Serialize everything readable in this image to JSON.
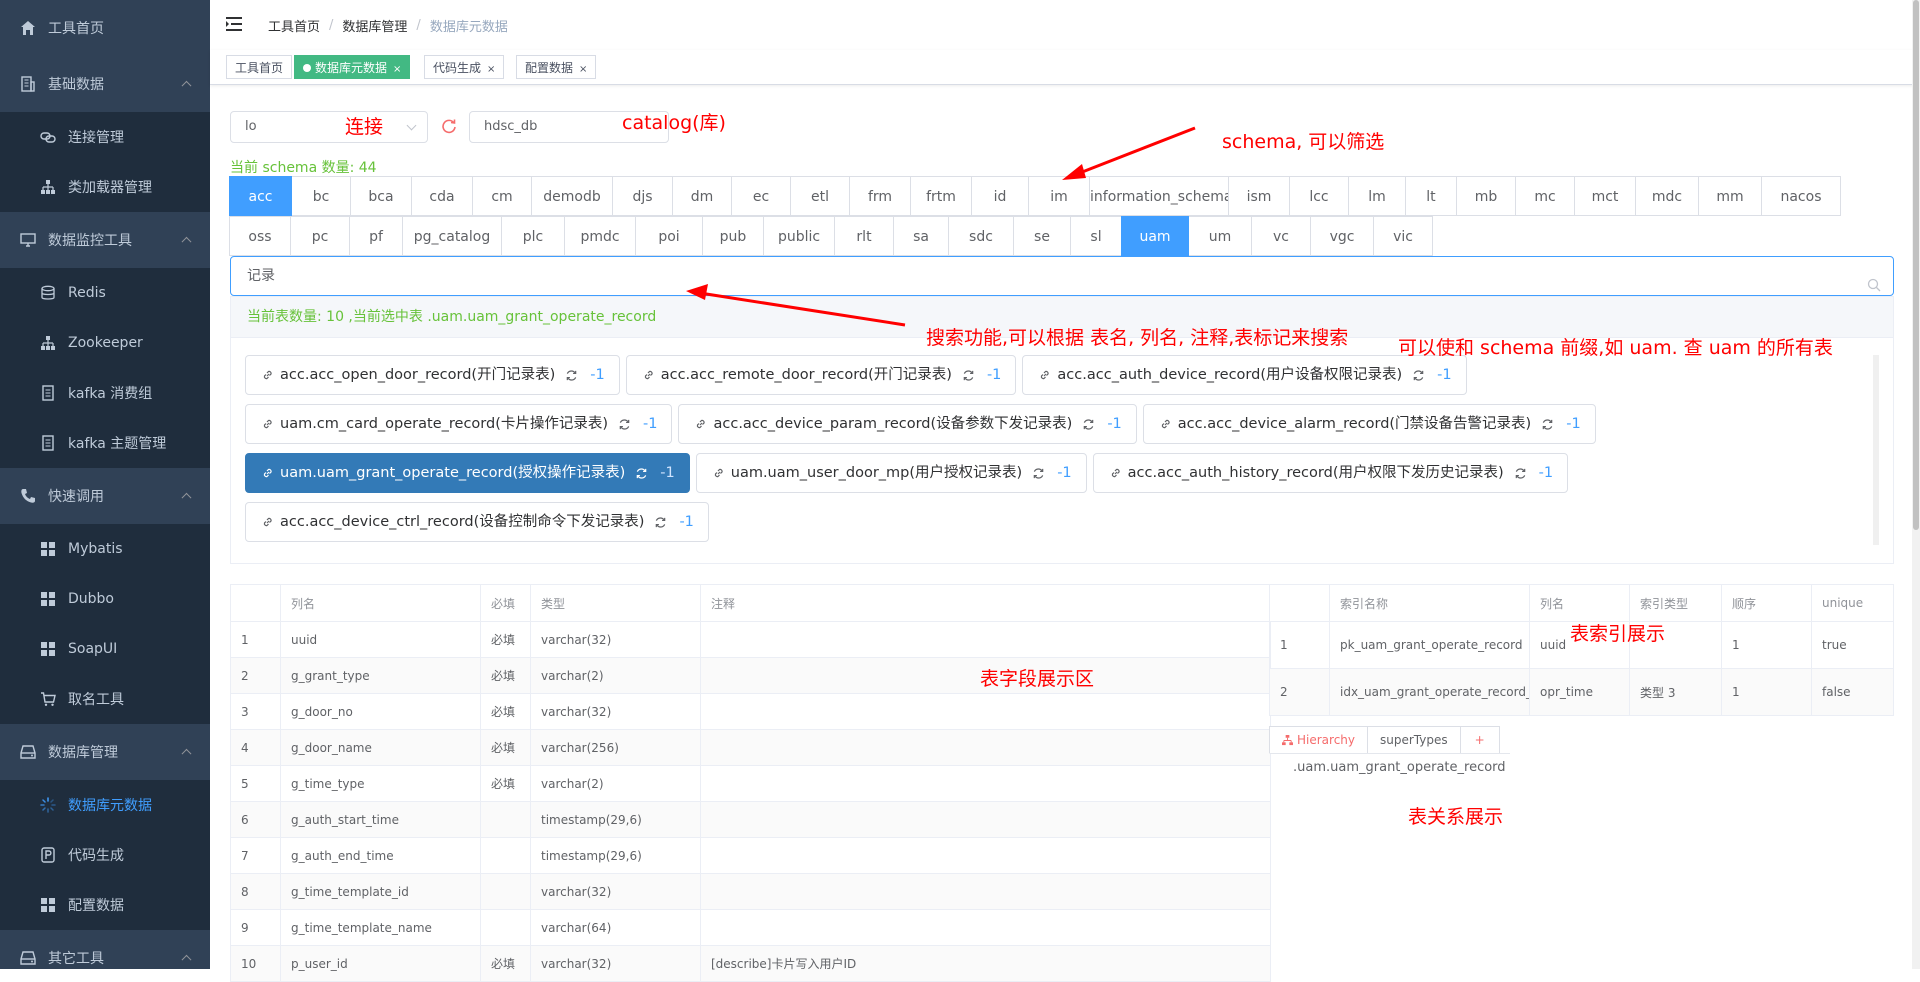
{
  "sidebar": {
    "items": [
      {
        "label": "工具首页",
        "icon": "home-icon",
        "type": "top"
      },
      {
        "label": "基础数据",
        "icon": "building-icon",
        "type": "top",
        "expandable": true
      },
      {
        "label": "连接管理",
        "icon": "link-icon",
        "type": "sub"
      },
      {
        "label": "类加载器管理",
        "icon": "sitemap-icon",
        "type": "sub"
      },
      {
        "label": "数据监控工具",
        "icon": "monitor-icon",
        "type": "top",
        "expandable": true
      },
      {
        "label": "Redis",
        "icon": "database-icon",
        "type": "sub"
      },
      {
        "label": "Zookeeper",
        "icon": "sitemap-icon",
        "type": "sub"
      },
      {
        "label": "kafka 消费组",
        "icon": "document-icon",
        "type": "sub"
      },
      {
        "label": "kafka 主题管理",
        "icon": "document-icon",
        "type": "sub"
      },
      {
        "label": "快速调用",
        "icon": "phone-icon",
        "type": "top",
        "expandable": true
      },
      {
        "label": "Mybatis",
        "icon": "grid-icon",
        "type": "sub"
      },
      {
        "label": "Dubbo",
        "icon": "grid-icon",
        "type": "sub"
      },
      {
        "label": "SoapUI",
        "icon": "grid-icon",
        "type": "sub"
      },
      {
        "label": "取名工具",
        "icon": "cart-icon",
        "type": "sub"
      },
      {
        "label": "数据库管理",
        "icon": "drive-icon",
        "type": "top",
        "expandable": true
      },
      {
        "label": "数据库元数据",
        "icon": "spinner-icon",
        "type": "sub",
        "active": true
      },
      {
        "label": "代码生成",
        "icon": "parking-icon",
        "type": "sub"
      },
      {
        "label": "配置数据",
        "icon": "grid-icon",
        "type": "sub"
      },
      {
        "label": "其它工具",
        "icon": "drive-icon",
        "type": "top",
        "expandable": true
      }
    ]
  },
  "breadcrumb": [
    "工具首页",
    "数据库管理",
    "数据库元数据"
  ],
  "tags": [
    {
      "label": "工具首页",
      "active": false,
      "closable": false
    },
    {
      "label": "数据库元数据",
      "active": true,
      "closable": true
    },
    {
      "label": "代码生成",
      "active": false,
      "closable": true
    },
    {
      "label": "配置数据",
      "active": false,
      "closable": true
    }
  ],
  "connection": {
    "value": "lo"
  },
  "catalog": {
    "value": "hdsc_db"
  },
  "schema_count_text": "当前 schema 数量: 44",
  "schemas_row1": [
    "acc",
    "bc",
    "bca",
    "cda",
    "cm",
    "demodb",
    "djs",
    "dm",
    "ec",
    "etl",
    "frm",
    "frtm",
    "id",
    "im",
    "information_schema",
    "ism",
    "lcc",
    "lm",
    "lt",
    "mb",
    "mc",
    "mct",
    "mdc",
    "mm",
    "nacos"
  ],
  "schemas_row2": [
    "oss",
    "pc",
    "pf",
    "pg_catalog",
    "plc",
    "pmdc",
    "poi",
    "pub",
    "public",
    "rlt",
    "sa",
    "sdc",
    "se",
    "sl",
    "uam",
    "um",
    "vc",
    "vgc",
    "vic"
  ],
  "active_schemas": [
    "acc",
    "uam"
  ],
  "search": {
    "value": "记录"
  },
  "table_panel": {
    "header": "当前表数量: 10 ,当前选中表 .uam.uam_grant_operate_record",
    "rows": [
      [
        {
          "label": "acc.acc_open_door_record(开门记录表)",
          "count": "-1"
        },
        {
          "label": "acc.acc_remote_door_record(开门记录表)",
          "count": "-1"
        },
        {
          "label": "acc.acc_auth_device_record(用户设备权限记录表)",
          "count": "-1"
        }
      ],
      [
        {
          "label": "uam.cm_card_operate_record(卡片操作记录表)",
          "count": "-1"
        },
        {
          "label": "acc.acc_device_param_record(设备参数下发记录表)",
          "count": "-1"
        },
        {
          "label": "acc.acc_device_alarm_record(门禁设备告警记录表)",
          "count": "-1"
        }
      ],
      [
        {
          "label": "uam.uam_grant_operate_record(授权操作记录表)",
          "count": "-1",
          "active": true
        },
        {
          "label": "uam.uam_user_door_mp(用户授权记录表)",
          "count": "-1"
        },
        {
          "label": "acc.acc_auth_history_record(用户权限下发历史记录表)",
          "count": "-1"
        }
      ],
      [
        {
          "label": "acc.acc_device_ctrl_record(设备控制命令下发记录表)",
          "count": "-1"
        }
      ]
    ]
  },
  "columns_table": {
    "headers": [
      "",
      "列名",
      "必填",
      "类型",
      "注释"
    ],
    "rows": [
      [
        "1",
        "uuid",
        "必填",
        "varchar(32)",
        ""
      ],
      [
        "2",
        "g_grant_type",
        "必填",
        "varchar(2)",
        ""
      ],
      [
        "3",
        "g_door_no",
        "必填",
        "varchar(32)",
        ""
      ],
      [
        "4",
        "g_door_name",
        "必填",
        "varchar(256)",
        ""
      ],
      [
        "5",
        "g_time_type",
        "必填",
        "varchar(2)",
        ""
      ],
      [
        "6",
        "g_auth_start_time",
        "",
        "timestamp(29,6)",
        ""
      ],
      [
        "7",
        "g_auth_end_time",
        "",
        "timestamp(29,6)",
        ""
      ],
      [
        "8",
        "g_time_template_id",
        "",
        "varchar(32)",
        ""
      ],
      [
        "9",
        "g_time_template_name",
        "",
        "varchar(64)",
        ""
      ],
      [
        "10",
        "p_user_id",
        "必填",
        "varchar(32)",
        "[describe]卡片写入用户ID"
      ]
    ]
  },
  "index_table": {
    "headers": [
      "",
      "索引名称",
      "列名",
      "索引类型",
      "顺序",
      "unique"
    ],
    "rows": [
      [
        "1",
        "pk_uam_grant_operate_record",
        "uuid",
        "",
        "1",
        "true"
      ],
      [
        "2",
        "idx_uam_grant_operate_record_time",
        "opr_time",
        "类型 3",
        "1",
        "false"
      ]
    ]
  },
  "relation": {
    "tabs": [
      "Hierarchy",
      "superTypes",
      "+"
    ],
    "node": ".uam.uam_grant_operate_record"
  },
  "annotations": {
    "conn": "连接",
    "catalog": "catalog(库)",
    "schema": "schema, 可以筛选",
    "search": "搜索功能,可以根据 表名, 列名, 注释,表标记来搜索",
    "prefix": "可以使和 schema 前缀,如 uam.  查 uam 的所有表",
    "fields": "表字段展示区",
    "index": "表索引展示",
    "relation": "表关系展示"
  },
  "colors": {
    "accent": "#409eff",
    "sidebar": "#304156",
    "success": "#67c23a",
    "selected_table": "#337ab7",
    "annotation": "#ff0000"
  }
}
